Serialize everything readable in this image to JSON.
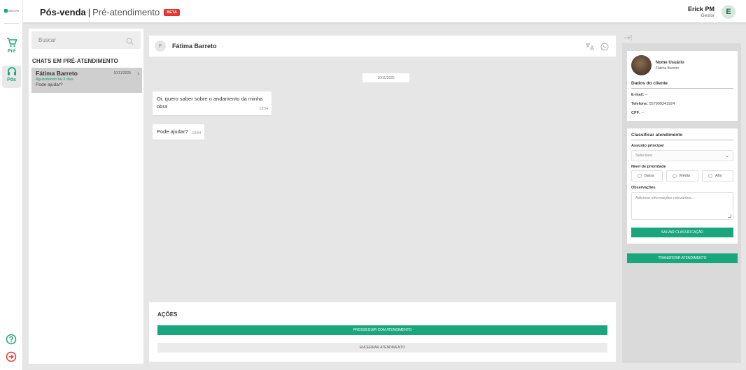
{
  "app": {
    "logo_text": "MICON",
    "title": "Pós-venda",
    "separator": "|",
    "subtitle": "Pré-atendimento",
    "badge": "BETA"
  },
  "user": {
    "name": "Erick PM",
    "role": "Gestor",
    "initial": "E"
  },
  "rail": {
    "items": [
      {
        "label": "Pré",
        "icon": "cart-icon"
      },
      {
        "label": "Pós",
        "icon": "headset-icon"
      }
    ],
    "bottom_icons": [
      "help-icon",
      "exit-icon"
    ]
  },
  "chat_list": {
    "search_placeholder": "Buscar",
    "section_title": "CHATS EM PRÉ-ATENDIMENTO",
    "items": [
      {
        "name": "Fátima Barreto",
        "date": "10/11/2025",
        "waiting": "Aguardando há 3 dias",
        "last_message": "Pode ajudar?"
      }
    ]
  },
  "conversation": {
    "initial": "F",
    "name": "Fátima Barreto",
    "date_separator": "10/11/2025",
    "messages": [
      {
        "text": "Oi, quero saber sobre o andamento da minha obra",
        "time": "13:54"
      },
      {
        "text": "Pode ajudar?",
        "time": "13:54"
      }
    ]
  },
  "actions": {
    "title": "AÇÕES",
    "proceed_label": "PROSSEGUIR COM ATENDIMENTO",
    "end_label": "ENCERRAR ATENDIMENTO"
  },
  "client": {
    "name_label": "Nome Usuário",
    "name_value": "Fátima Barreto",
    "section_title": "Dados do cliente",
    "email_label": "E-mail:",
    "email_value": "--",
    "phone_label": "Telefone:",
    "phone_value": "557999341924",
    "cpf_label": "CPF:",
    "cpf_value": "--"
  },
  "classify": {
    "title": "Classificar atendimento",
    "subject_label": "Assunto principal",
    "subject_selected": "Selecione",
    "priority_label": "Nível de prioridade",
    "priority_options": [
      "Baixa",
      "Média",
      "Alta"
    ],
    "notes_label": "Observações",
    "notes_placeholder": "Adicione informações relevantes...",
    "save_label": "SALVAR CLASSIFICAÇÃO"
  },
  "transfer_label": "TRANSFERIR ATENDIMENTO",
  "colors": {
    "accent": "#1aa67d",
    "badge": "#e3342f",
    "background": "#e6e6e6"
  }
}
